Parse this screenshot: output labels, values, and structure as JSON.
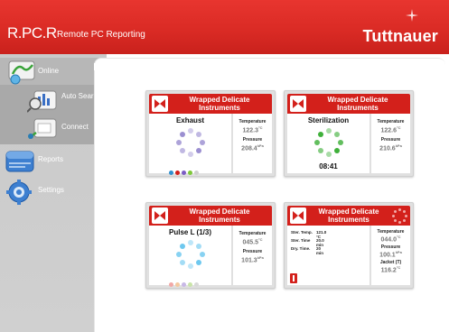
{
  "header": {
    "app_short": "R.PC.R",
    "app_full": "Remote PC Reporting",
    "brand": "Tuttnauer",
    "color": "#d92a24"
  },
  "sidebar": {
    "items": [
      {
        "label": "Online",
        "icon": "online-icon"
      },
      {
        "label": "Auto Search",
        "icon": "auto-search-icon"
      },
      {
        "label": "Connect",
        "icon": "connect-icon"
      },
      {
        "label": "Reports",
        "icon": "reports-icon"
      },
      {
        "label": "Settings",
        "icon": "settings-gear-icon"
      }
    ]
  },
  "cards": [
    {
      "title": "Wrapped Delicate Instruments",
      "stage": "Exhaust",
      "temperature_label": "Temperature",
      "temperature": "122.3",
      "temperature_unit": "°C",
      "pressure_label": "Pressure",
      "pressure": "208.4",
      "pressure_unit": "kPa",
      "ring_color": "#9b8fd1",
      "dot_colors": [
        "#2f8fcf",
        "#d3201b",
        "#7b5cc4",
        "#7ec83a",
        "#cfcfcf"
      ]
    },
    {
      "title": "Wrapped Delicate Instruments",
      "stage": "Sterilization",
      "timer": "08:41",
      "temperature_label": "Temperature",
      "temperature": "122.6",
      "temperature_unit": "°C",
      "pressure_label": "Pressure",
      "pressure": "210.6",
      "pressure_unit": "kPa",
      "ring_color": "#3fb03a"
    },
    {
      "title": "Wrapped Delicate Instruments",
      "stage": "Pulse L (1/3)",
      "temperature_label": "Temperature",
      "temperature": "045.5",
      "temperature_unit": "°C",
      "pressure_label": "Pressure",
      "pressure": "101.3",
      "pressure_unit": "kPa",
      "ring_color": "#6ec8ef",
      "dot_colors": [
        "#f2a8a6",
        "#f4c9a0",
        "#c8b8e6",
        "#c9e4a8",
        "#d9d9d9"
      ]
    },
    {
      "title": "Wrapped Delicate Instruments",
      "ster_temp_label": "Ster. Temp.",
      "ster_temp": "121.0 °C",
      "ster_time_label": "Ster. Time",
      "ster_time": "20.0 min",
      "dry_time_label": "Dry. Time.",
      "dry_time": "20 min",
      "temperature_label": "Temperature",
      "temperature": "044.0",
      "temperature_unit": "°C",
      "pressure_label": "Pressure",
      "pressure": "100.1",
      "pressure_unit": "kPa",
      "jacket_label": "Jacket (T)",
      "jacket": "116.2",
      "jacket_unit": "°C"
    }
  ]
}
